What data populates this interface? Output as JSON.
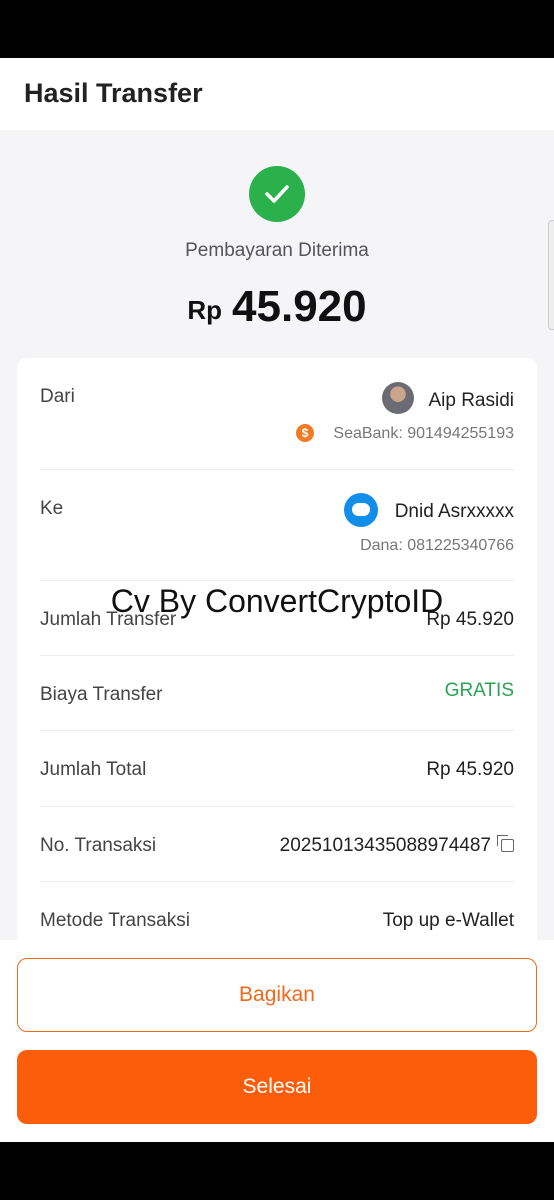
{
  "header": {
    "title": "Hasil Transfer"
  },
  "status": {
    "icon": "check-circle-icon",
    "text": "Pembayaran Diterima",
    "color": "#2bb14b"
  },
  "amount": {
    "currency": "Rp",
    "value": "45.920"
  },
  "details": {
    "from": {
      "label": "Dari",
      "name": "Aip Rasidi",
      "bank_icon": "seabank-icon",
      "account": "SeaBank: 901494255193"
    },
    "to": {
      "label": "Ke",
      "name": "Dnid Asrxxxxx",
      "wallet_icon": "dana-icon",
      "account": "Dana: 081225340766"
    },
    "transfer_amount": {
      "label": "Jumlah Transfer",
      "value": "Rp 45.920"
    },
    "fee": {
      "label": "Biaya Transfer",
      "value": "GRATIS"
    },
    "total": {
      "label": "Jumlah Total",
      "value": "Rp 45.920"
    },
    "transaction_no": {
      "label": "No. Transaksi",
      "value": "20251013435088974487"
    },
    "method": {
      "label": "Metode Transaksi",
      "value": "Top up e-Wallet"
    }
  },
  "watermark": "Cv By ConvertCryptoID",
  "buttons": {
    "share": "Bagikan",
    "done": "Selesai"
  },
  "colors": {
    "accent": "#fb5d0a",
    "success": "#2aa352",
    "wallet": "#118eea"
  }
}
